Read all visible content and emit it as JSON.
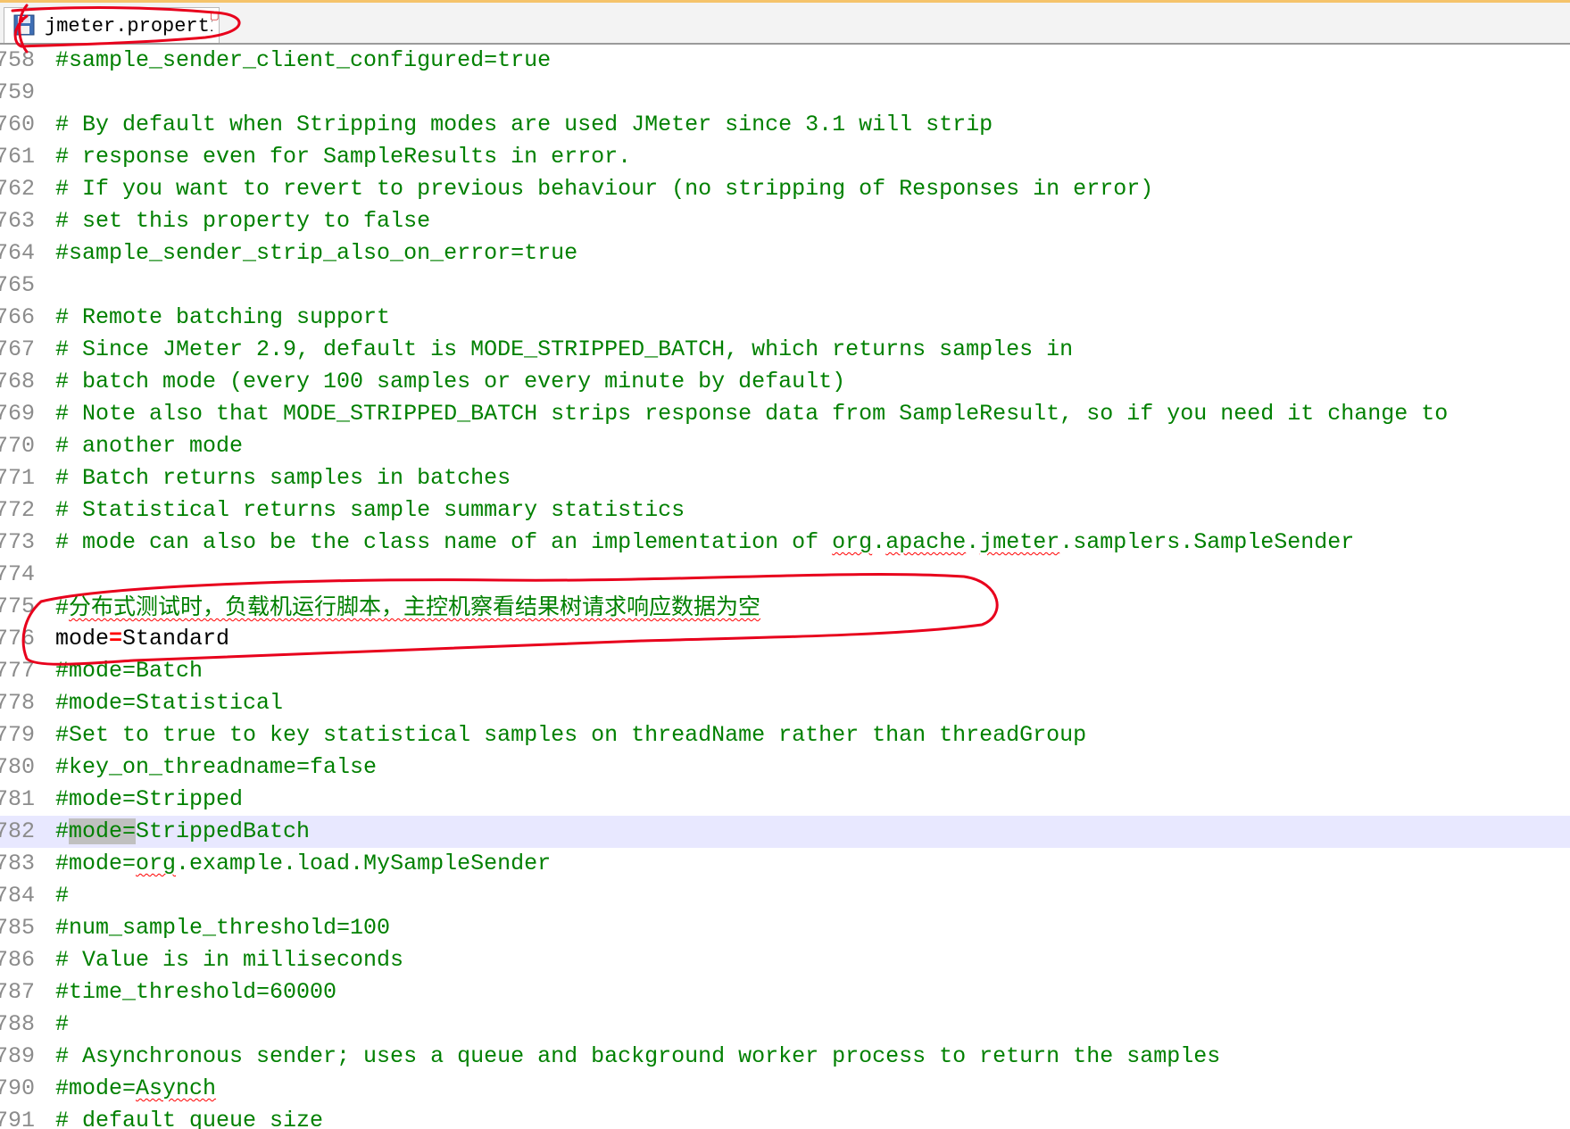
{
  "tab": {
    "filename": "jmeter.properties",
    "display_label": "jmeter.properti",
    "modified_icon": "save-icon"
  },
  "colors": {
    "comment": "#008000",
    "key": "#000000",
    "operator": "#ff0000",
    "line_number": "#8c8c8c",
    "current_line": "#e8e8ff",
    "annotation": "#e8001c"
  },
  "editor": {
    "current_line": "782",
    "lines": [
      {
        "no": "758",
        "segments": [
          {
            "t": "#sample_sender_client_configured=true",
            "c": "comment"
          }
        ]
      },
      {
        "no": "759",
        "segments": []
      },
      {
        "no": "760",
        "segments": [
          {
            "t": "# By default when Stripping modes are used JMeter since 3.1 will strip",
            "c": "comment"
          }
        ]
      },
      {
        "no": "761",
        "segments": [
          {
            "t": "# response even for SampleResults in error.",
            "c": "comment"
          }
        ]
      },
      {
        "no": "762",
        "segments": [
          {
            "t": "# If you want to revert to previous behaviour (no stripping of Responses in error)",
            "c": "comment"
          }
        ]
      },
      {
        "no": "763",
        "segments": [
          {
            "t": "# set this property to false",
            "c": "comment"
          }
        ]
      },
      {
        "no": "764",
        "segments": [
          {
            "t": "#sample_sender_strip_also_on_error=true",
            "c": "comment"
          }
        ]
      },
      {
        "no": "765",
        "segments": []
      },
      {
        "no": "766",
        "segments": [
          {
            "t": "# Remote batching support",
            "c": "comment"
          }
        ]
      },
      {
        "no": "767",
        "segments": [
          {
            "t": "# Since JMeter 2.9, default is MODE_STRIPPED_BATCH, which returns samples in",
            "c": "comment"
          }
        ]
      },
      {
        "no": "768",
        "segments": [
          {
            "t": "# batch mode (every 100 samples or every minute by default)",
            "c": "comment"
          }
        ]
      },
      {
        "no": "769",
        "segments": [
          {
            "t": "# Note also that MODE_STRIPPED_BATCH strips response data from SampleResult, so if you need it change to",
            "c": "comment"
          }
        ]
      },
      {
        "no": "770",
        "segments": [
          {
            "t": "# another mode",
            "c": "comment"
          }
        ]
      },
      {
        "no": "771",
        "segments": [
          {
            "t": "# Batch returns samples in batches",
            "c": "comment"
          }
        ]
      },
      {
        "no": "772",
        "segments": [
          {
            "t": "# Statistical returns sample summary statistics",
            "c": "comment"
          }
        ]
      },
      {
        "no": "773",
        "segments": [
          {
            "t": "# mode can also be the class name of an implementation of ",
            "c": "comment"
          },
          {
            "t": "org",
            "c": "comment",
            "spell": true
          },
          {
            "t": ".",
            "c": "comment"
          },
          {
            "t": "apache",
            "c": "comment",
            "spell": true
          },
          {
            "t": ".",
            "c": "comment"
          },
          {
            "t": "jmeter",
            "c": "comment",
            "spell": true
          },
          {
            "t": ".samplers.SampleSender",
            "c": "comment"
          }
        ]
      },
      {
        "no": "774",
        "segments": []
      },
      {
        "no": "775",
        "segments": [
          {
            "t": "#",
            "c": "comment"
          },
          {
            "t": "分布式测试时，负载机运行脚本，主控机察看结果树请求响应数据为空",
            "c": "comment",
            "spell": true,
            "cjk": true
          }
        ]
      },
      {
        "no": "776",
        "segments": [
          {
            "t": "mode",
            "c": "key"
          },
          {
            "t": "=",
            "c": "op"
          },
          {
            "t": "Standard",
            "c": "val"
          }
        ]
      },
      {
        "no": "777",
        "segments": [
          {
            "t": "#mode=Batch",
            "c": "comment"
          }
        ]
      },
      {
        "no": "778",
        "segments": [
          {
            "t": "#mode=Statistical",
            "c": "comment"
          }
        ]
      },
      {
        "no": "779",
        "segments": [
          {
            "t": "#Set to true to key statistical samples on threadName rather than threadGroup",
            "c": "comment"
          }
        ]
      },
      {
        "no": "780",
        "segments": [
          {
            "t": "#key_on_threadname=false",
            "c": "comment"
          }
        ]
      },
      {
        "no": "781",
        "segments": [
          {
            "t": "#mode=Stripped",
            "c": "comment"
          }
        ]
      },
      {
        "no": "782",
        "segments": [
          {
            "t": "#",
            "c": "comment"
          },
          {
            "t": "mode=",
            "c": "comment",
            "sel": true
          },
          {
            "t": "StrippedBatch",
            "c": "comment"
          }
        ]
      },
      {
        "no": "783",
        "segments": [
          {
            "t": "#mode=",
            "c": "comment"
          },
          {
            "t": "org",
            "c": "comment",
            "spell": true
          },
          {
            "t": ".example.load.MySampleSender",
            "c": "comment"
          }
        ]
      },
      {
        "no": "784",
        "segments": [
          {
            "t": "#",
            "c": "comment"
          }
        ]
      },
      {
        "no": "785",
        "segments": [
          {
            "t": "#num_sample_threshold=100",
            "c": "comment"
          }
        ]
      },
      {
        "no": "786",
        "segments": [
          {
            "t": "# Value is in milliseconds",
            "c": "comment"
          }
        ]
      },
      {
        "no": "787",
        "segments": [
          {
            "t": "#time_threshold=60000",
            "c": "comment"
          }
        ]
      },
      {
        "no": "788",
        "segments": [
          {
            "t": "#",
            "c": "comment"
          }
        ]
      },
      {
        "no": "789",
        "segments": [
          {
            "t": "# Asynchronous sender; uses a queue and background worker process to return the samples",
            "c": "comment"
          }
        ]
      },
      {
        "no": "790",
        "segments": [
          {
            "t": "#mode=",
            "c": "comment"
          },
          {
            "t": "Asynch",
            "c": "comment",
            "spell": true
          }
        ]
      },
      {
        "no": "791",
        "segments": [
          {
            "t": "# default queue size",
            "c": "comment"
          }
        ]
      }
    ]
  }
}
